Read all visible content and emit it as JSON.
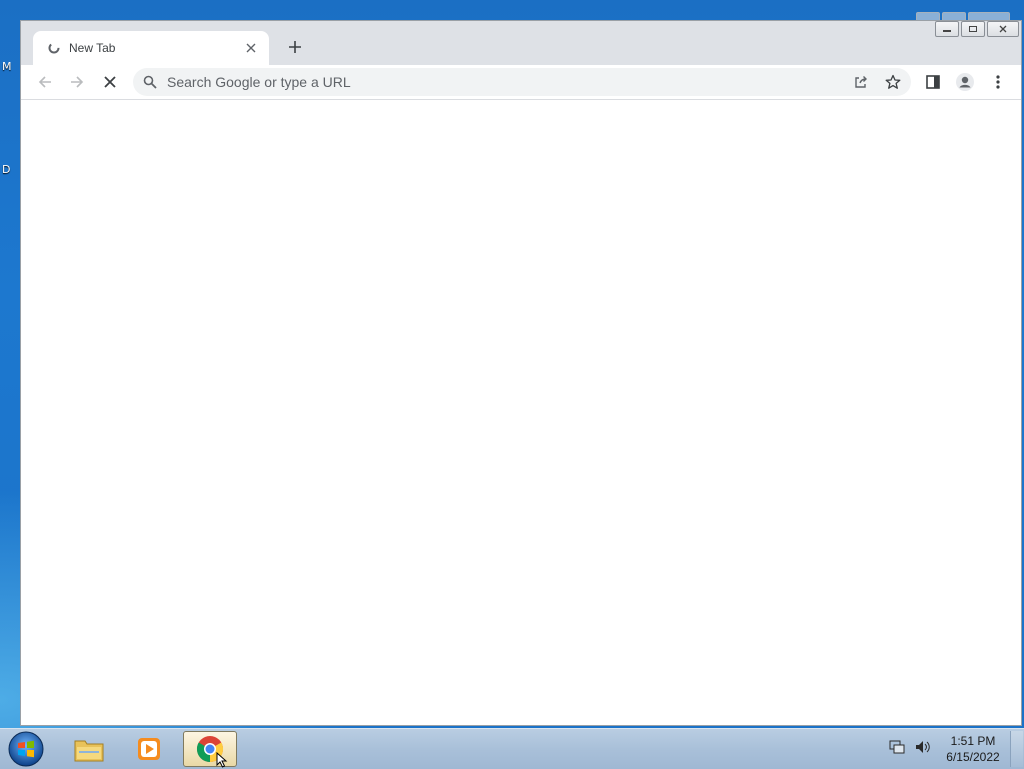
{
  "desktop": {
    "left_letters": [
      "M",
      "D"
    ]
  },
  "browser": {
    "tab": {
      "title": "New Tab"
    },
    "omnibox": {
      "placeholder": "Search Google or type a URL",
      "value": ""
    }
  },
  "taskbar": {
    "clock": {
      "time": "1:51 PM",
      "date": "6/15/2022"
    }
  },
  "colors": {
    "accent": "#1a73e8",
    "taskbar": "#a9c0d9"
  },
  "icons": {
    "toolbar": [
      "back-icon",
      "forward-icon",
      "stop-icon",
      "search-icon",
      "share-icon",
      "bookmark-star-icon",
      "side-panel-icon",
      "profile-icon",
      "menu-icon"
    ],
    "taskbar": [
      "windows-start-icon",
      "file-explorer-icon",
      "media-player-icon",
      "chrome-icon"
    ],
    "tray": [
      "network-icon",
      "volume-icon"
    ]
  }
}
